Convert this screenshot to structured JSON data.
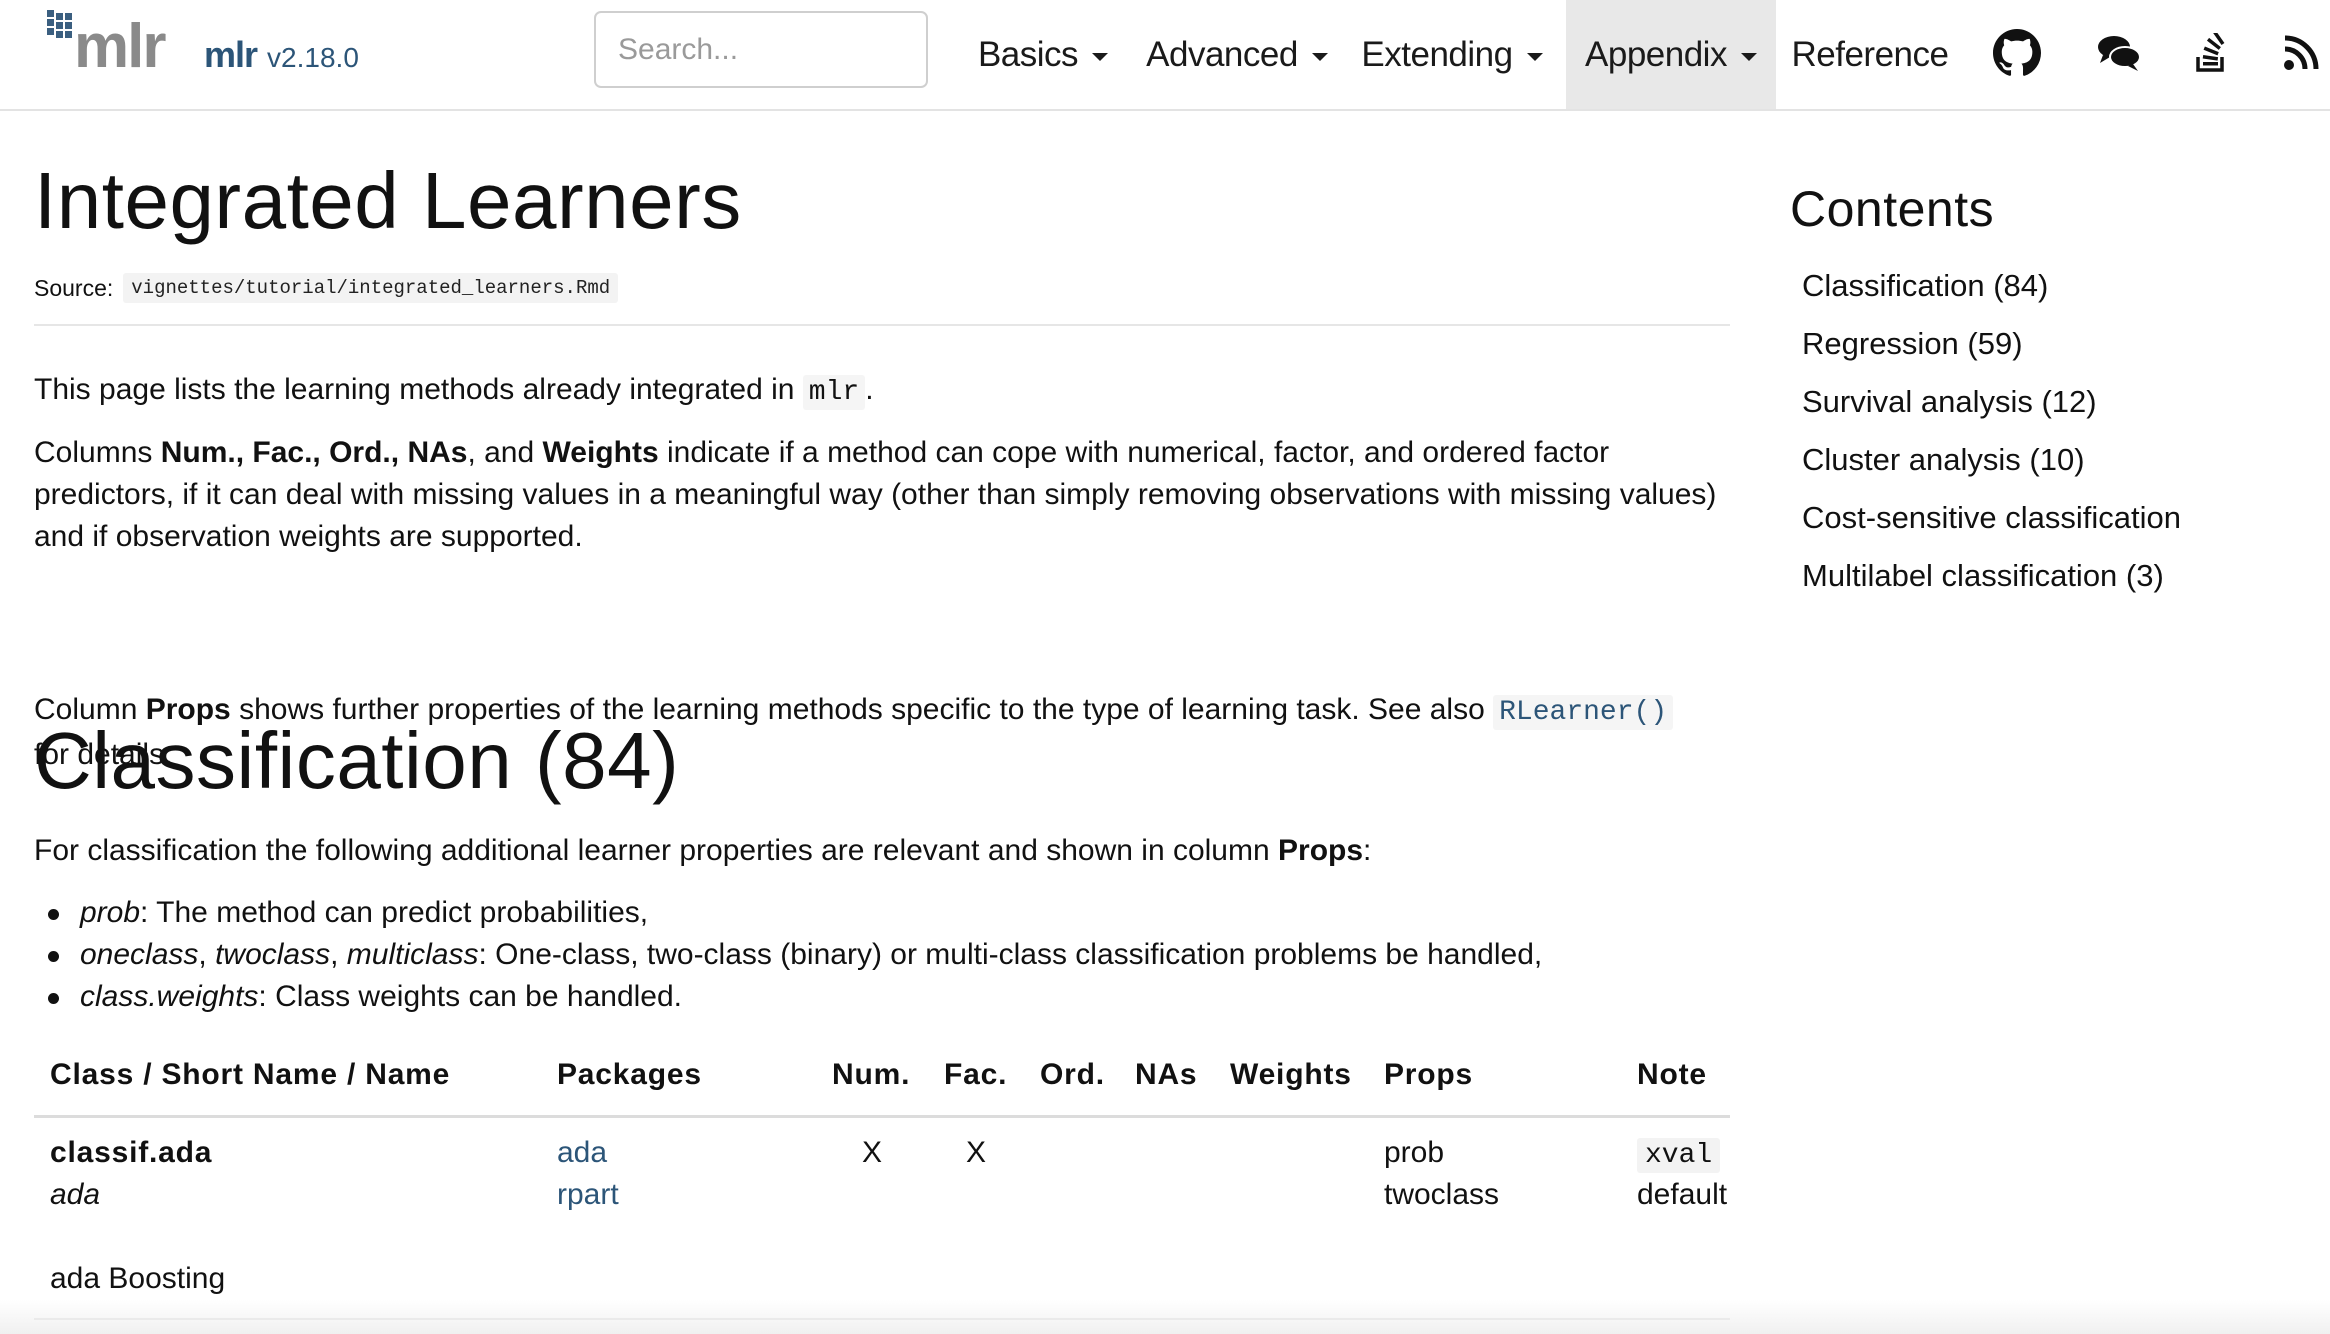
{
  "navbar": {
    "logo_text": "mlr",
    "brand": "mlr",
    "version": "v2.18.0",
    "search_placeholder": "Search...",
    "menu": [
      {
        "label": "Basics",
        "dropdown": true
      },
      {
        "label": "Advanced",
        "dropdown": true
      },
      {
        "label": "Extending",
        "dropdown": true
      },
      {
        "label": "Appendix",
        "dropdown": true,
        "active": true
      },
      {
        "label": "Reference",
        "dropdown": false
      }
    ],
    "icons": [
      "github-icon",
      "chat-icon",
      "stackoverflow-icon",
      "rss-icon"
    ]
  },
  "page": {
    "title": "Integrated Learners",
    "source_label": "Source:",
    "source_path": "vignettes/tutorial/integrated_learners.Rmd",
    "intro": {
      "p1_before": "This page lists the learning methods already integrated in ",
      "p1_code": "mlr",
      "p1_after": ".",
      "p2_a": "Columns ",
      "p2_num": "Num.",
      "p2_comma1": ", ",
      "p2_fac": "Fac.",
      "p2_comma2": ", ",
      "p2_ord": "Ord.",
      "p2_comma3": ", ",
      "p2_nas": "NAs",
      "p2_and": ", and ",
      "p2_weights": "Weights",
      "p2_line1_rest": " indicate if a method can cope with numerical, factor, and ordered factor",
      "p2_line2": "predictors, if it can deal with missing values in a meaningful way (other than simply removing observations with missing values)",
      "p2_line3": "and if observation weights are supported.",
      "p3_a": "Column ",
      "p3_props": "Props",
      "p3_b": " shows further properties of the learning methods specific to the type of learning task. See also ",
      "p3_code": "RLearner()",
      "p3_line2": "for details."
    }
  },
  "classification": {
    "title": "Classification (84)",
    "desc_before": "For classification the following additional learner properties are relevant and shown in column ",
    "desc_bold": "Props",
    "desc_after": ":",
    "bullets": [
      {
        "em": "prob",
        "text": ": The method can predict probabilities,"
      },
      {
        "em1": "oneclass",
        "sep1": ", ",
        "em2": "twoclass",
        "sep2": ", ",
        "em3": "multiclass",
        "text": ": One-class, two-class (binary) or multi-class classification problems be handled,"
      },
      {
        "em": "class.weights",
        "text": ": Class weights can be handled."
      }
    ],
    "table": {
      "headers": [
        "Class / Short Name / Name",
        "Packages",
        "Num.",
        "Fac.",
        "Ord.",
        "NAs",
        "Weights",
        "Props",
        "Note"
      ],
      "rows": [
        {
          "class": "classif.ada",
          "short_name": "ada",
          "name": "ada Boosting",
          "packages": [
            "ada",
            "rpart"
          ],
          "num": "X",
          "fac": "X",
          "ord": "",
          "nas": "",
          "weights": "",
          "props": [
            "prob",
            "twoclass"
          ],
          "note_code": "xval",
          "note_text": "default"
        }
      ]
    }
  },
  "toc": {
    "title": "Contents",
    "items": [
      "Classification (84)",
      "Regression (59)",
      "Survival analysis (12)",
      "Cluster analysis (10)",
      "Cost-sensitive classification",
      "Multilabel classification (3)"
    ]
  },
  "colors": {
    "brand": "#2c5578",
    "link": "#2c5578",
    "active_nav_bg": "#e8e8e8"
  }
}
